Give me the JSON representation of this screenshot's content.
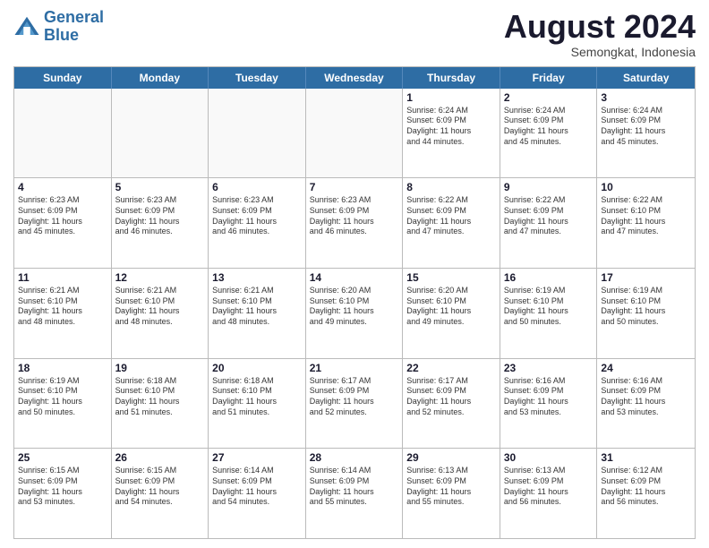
{
  "logo": {
    "line1": "General",
    "line2": "Blue"
  },
  "header": {
    "month": "August 2024",
    "location": "Semongkat, Indonesia"
  },
  "days": [
    "Sunday",
    "Monday",
    "Tuesday",
    "Wednesday",
    "Thursday",
    "Friday",
    "Saturday"
  ],
  "weeks": [
    [
      {
        "day": "",
        "content": "",
        "empty": true
      },
      {
        "day": "",
        "content": "",
        "empty": true
      },
      {
        "day": "",
        "content": "",
        "empty": true
      },
      {
        "day": "",
        "content": "",
        "empty": true
      },
      {
        "day": "1",
        "content": "Sunrise: 6:24 AM\nSunset: 6:09 PM\nDaylight: 11 hours\nand 44 minutes.",
        "empty": false
      },
      {
        "day": "2",
        "content": "Sunrise: 6:24 AM\nSunset: 6:09 PM\nDaylight: 11 hours\nand 45 minutes.",
        "empty": false
      },
      {
        "day": "3",
        "content": "Sunrise: 6:24 AM\nSunset: 6:09 PM\nDaylight: 11 hours\nand 45 minutes.",
        "empty": false
      }
    ],
    [
      {
        "day": "4",
        "content": "Sunrise: 6:23 AM\nSunset: 6:09 PM\nDaylight: 11 hours\nand 45 minutes.",
        "empty": false
      },
      {
        "day": "5",
        "content": "Sunrise: 6:23 AM\nSunset: 6:09 PM\nDaylight: 11 hours\nand 46 minutes.",
        "empty": false
      },
      {
        "day": "6",
        "content": "Sunrise: 6:23 AM\nSunset: 6:09 PM\nDaylight: 11 hours\nand 46 minutes.",
        "empty": false
      },
      {
        "day": "7",
        "content": "Sunrise: 6:23 AM\nSunset: 6:09 PM\nDaylight: 11 hours\nand 46 minutes.",
        "empty": false
      },
      {
        "day": "8",
        "content": "Sunrise: 6:22 AM\nSunset: 6:09 PM\nDaylight: 11 hours\nand 47 minutes.",
        "empty": false
      },
      {
        "day": "9",
        "content": "Sunrise: 6:22 AM\nSunset: 6:09 PM\nDaylight: 11 hours\nand 47 minutes.",
        "empty": false
      },
      {
        "day": "10",
        "content": "Sunrise: 6:22 AM\nSunset: 6:10 PM\nDaylight: 11 hours\nand 47 minutes.",
        "empty": false
      }
    ],
    [
      {
        "day": "11",
        "content": "Sunrise: 6:21 AM\nSunset: 6:10 PM\nDaylight: 11 hours\nand 48 minutes.",
        "empty": false
      },
      {
        "day": "12",
        "content": "Sunrise: 6:21 AM\nSunset: 6:10 PM\nDaylight: 11 hours\nand 48 minutes.",
        "empty": false
      },
      {
        "day": "13",
        "content": "Sunrise: 6:21 AM\nSunset: 6:10 PM\nDaylight: 11 hours\nand 48 minutes.",
        "empty": false
      },
      {
        "day": "14",
        "content": "Sunrise: 6:20 AM\nSunset: 6:10 PM\nDaylight: 11 hours\nand 49 minutes.",
        "empty": false
      },
      {
        "day": "15",
        "content": "Sunrise: 6:20 AM\nSunset: 6:10 PM\nDaylight: 11 hours\nand 49 minutes.",
        "empty": false
      },
      {
        "day": "16",
        "content": "Sunrise: 6:19 AM\nSunset: 6:10 PM\nDaylight: 11 hours\nand 50 minutes.",
        "empty": false
      },
      {
        "day": "17",
        "content": "Sunrise: 6:19 AM\nSunset: 6:10 PM\nDaylight: 11 hours\nand 50 minutes.",
        "empty": false
      }
    ],
    [
      {
        "day": "18",
        "content": "Sunrise: 6:19 AM\nSunset: 6:10 PM\nDaylight: 11 hours\nand 50 minutes.",
        "empty": false
      },
      {
        "day": "19",
        "content": "Sunrise: 6:18 AM\nSunset: 6:10 PM\nDaylight: 11 hours\nand 51 minutes.",
        "empty": false
      },
      {
        "day": "20",
        "content": "Sunrise: 6:18 AM\nSunset: 6:10 PM\nDaylight: 11 hours\nand 51 minutes.",
        "empty": false
      },
      {
        "day": "21",
        "content": "Sunrise: 6:17 AM\nSunset: 6:09 PM\nDaylight: 11 hours\nand 52 minutes.",
        "empty": false
      },
      {
        "day": "22",
        "content": "Sunrise: 6:17 AM\nSunset: 6:09 PM\nDaylight: 11 hours\nand 52 minutes.",
        "empty": false
      },
      {
        "day": "23",
        "content": "Sunrise: 6:16 AM\nSunset: 6:09 PM\nDaylight: 11 hours\nand 53 minutes.",
        "empty": false
      },
      {
        "day": "24",
        "content": "Sunrise: 6:16 AM\nSunset: 6:09 PM\nDaylight: 11 hours\nand 53 minutes.",
        "empty": false
      }
    ],
    [
      {
        "day": "25",
        "content": "Sunrise: 6:15 AM\nSunset: 6:09 PM\nDaylight: 11 hours\nand 53 minutes.",
        "empty": false
      },
      {
        "day": "26",
        "content": "Sunrise: 6:15 AM\nSunset: 6:09 PM\nDaylight: 11 hours\nand 54 minutes.",
        "empty": false
      },
      {
        "day": "27",
        "content": "Sunrise: 6:14 AM\nSunset: 6:09 PM\nDaylight: 11 hours\nand 54 minutes.",
        "empty": false
      },
      {
        "day": "28",
        "content": "Sunrise: 6:14 AM\nSunset: 6:09 PM\nDaylight: 11 hours\nand 55 minutes.",
        "empty": false
      },
      {
        "day": "29",
        "content": "Sunrise: 6:13 AM\nSunset: 6:09 PM\nDaylight: 11 hours\nand 55 minutes.",
        "empty": false
      },
      {
        "day": "30",
        "content": "Sunrise: 6:13 AM\nSunset: 6:09 PM\nDaylight: 11 hours\nand 56 minutes.",
        "empty": false
      },
      {
        "day": "31",
        "content": "Sunrise: 6:12 AM\nSunset: 6:09 PM\nDaylight: 11 hours\nand 56 minutes.",
        "empty": false
      }
    ]
  ]
}
